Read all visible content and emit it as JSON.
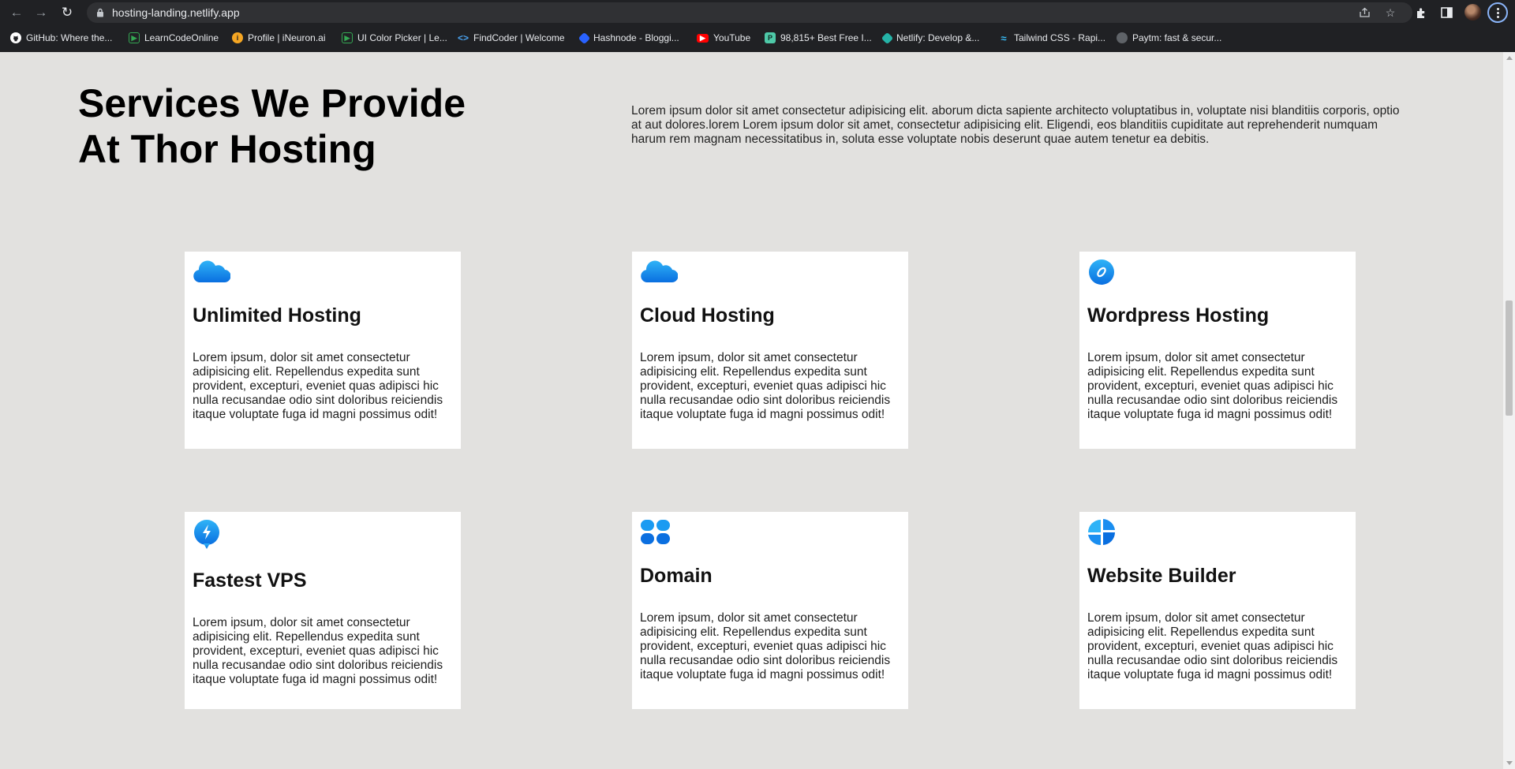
{
  "browser": {
    "url": "hosting-landing.netlify.app",
    "bookmarks": [
      {
        "label": "GitHub: Where the...",
        "icon": "github-icon"
      },
      {
        "label": "LearnCodeOnline",
        "icon": "learncodeonline-icon"
      },
      {
        "label": "Profile | iNeuron.ai",
        "icon": "ineuron-icon"
      },
      {
        "label": "UI Color Picker | Le...",
        "icon": "ui-color-picker-icon"
      },
      {
        "label": "FindCoder | Welcome",
        "icon": "findcoder-icon"
      },
      {
        "label": "Hashnode - Bloggi...",
        "icon": "hashnode-icon"
      },
      {
        "label": "YouTube",
        "icon": "youtube-icon"
      },
      {
        "label": "98,815+ Best Free I...",
        "icon": "freepik-icon"
      },
      {
        "label": "Netlify: Develop &...",
        "icon": "netlify-icon"
      },
      {
        "label": "Tailwind CSS - Rapi...",
        "icon": "tailwind-icon"
      },
      {
        "label": "Paytm: fast & secur...",
        "icon": "globe-icon"
      }
    ]
  },
  "page": {
    "title": "Services We Provide At Thor Hosting",
    "intro": "Lorem ipsum dolor sit amet consectetur adipisicing elit. aborum dicta sapiente architecto voluptatibus in, voluptate nisi blanditiis corporis, optio at aut dolores.lorem Lorem ipsum dolor sit amet, consectetur adipisicing elit. Eligendi, eos blanditiis cupiditate aut reprehenderit numquam harum rem magnam necessitatibus in, soluta esse voluptate nobis deserunt quae autem tenetur ea debitis.",
    "services": [
      {
        "title": "Unlimited Hosting",
        "icon": "cloud-icon",
        "text": "Lorem ipsum, dolor sit amet consectetur adipisicing elit. Repellendus expedita sunt provident, excepturi, eveniet quas adipisci hic nulla recusandae odio sint doloribus reiciendis itaque voluptate fuga id magni possimus odit!"
      },
      {
        "title": "Cloud Hosting",
        "icon": "cloud-icon",
        "text": "Lorem ipsum, dolor sit amet consectetur adipisicing elit. Repellendus expedita sunt provident, excepturi, eveniet quas adipisci hic nulla recusandae odio sint doloribus reiciendis itaque voluptate fuga id magni possimus odit!"
      },
      {
        "title": "Wordpress Hosting",
        "icon": "wordpress-icon",
        "text": "Lorem ipsum, dolor sit amet consectetur adipisicing elit. Repellendus expedita sunt provident, excepturi, eveniet quas adipisci hic nulla recusandae odio sint doloribus reiciendis itaque voluptate fuga id magni possimus odit!"
      },
      {
        "title": "Fastest VPS",
        "icon": "lightning-icon",
        "text": "Lorem ipsum, dolor sit amet consectetur adipisicing elit. Repellendus expedita sunt provident, excepturi, eveniet quas adipisci hic nulla recusandae odio sint doloribus reiciendis itaque voluptate fuga id magni possimus odit!"
      },
      {
        "title": "Domain",
        "icon": "grid-icon",
        "text": "Lorem ipsum, dolor sit amet consectetur adipisicing elit. Repellendus expedita sunt provident, excepturi, eveniet quas adipisci hic nulla recusandae odio sint doloribus reiciendis itaque voluptate fuga id magni possimus odit!"
      },
      {
        "title": "Website Builder",
        "icon": "pie-chart-icon",
        "text": "Lorem ipsum, dolor sit amet consectetur adipisicing elit. Repellendus expedita sunt provident, excepturi, eveniet quas adipisci hic nulla recusandae odio sint doloribus reiciendis itaque voluptate fuga id magni possimus odit!"
      }
    ]
  },
  "colors": {
    "page_background": "#e2e1df",
    "card_background": "#ffffff",
    "icon_blue": "#1a8ef0",
    "chrome_background": "#202124"
  }
}
